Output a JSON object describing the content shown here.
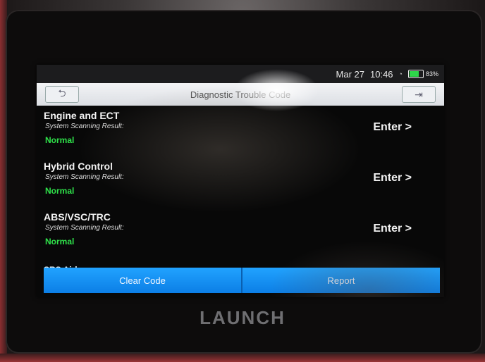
{
  "status_bar": {
    "date": "Mar 27",
    "time": "10:46",
    "battery": "83%"
  },
  "title_bar": {
    "title": "Diagnostic Trouble Code",
    "back_icon": "back-arrow-icon",
    "exit_icon": "exit-icon"
  },
  "systems": [
    {
      "name": "Engine and ECT",
      "result_label": "System Scanning Result:",
      "status": "Normal",
      "action": "Enter >"
    },
    {
      "name": "Hybrid Control",
      "result_label": "System Scanning Result:",
      "status": "Normal",
      "action": "Enter >"
    },
    {
      "name": "ABS/VSC/TRC",
      "result_label": "System Scanning Result:",
      "status": "Normal",
      "action": "Enter >"
    }
  ],
  "partial_item": "SRS Airbag",
  "bottom_bar": {
    "clear_code": "Clear Code",
    "report": "Report"
  },
  "brand": "LAUNCH",
  "colors": {
    "normal_status": "#2fe24a",
    "button_blue": "#1690f0",
    "title_bar": "#e6e8eb"
  }
}
